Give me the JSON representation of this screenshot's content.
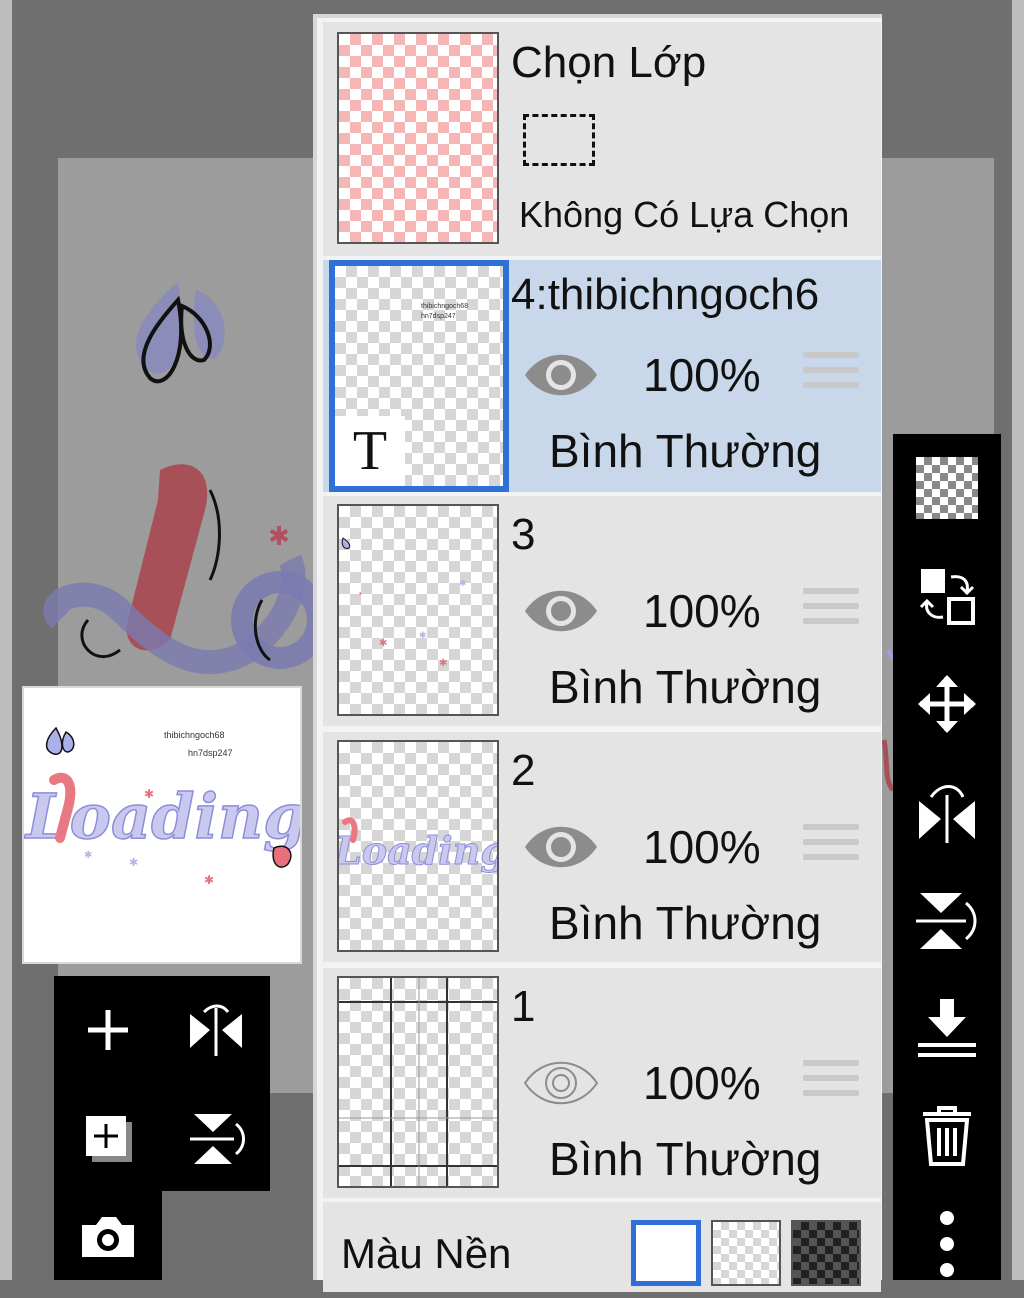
{
  "selection_layer": {
    "title": "Chọn Lớp",
    "status": "Không Có Lựa Chọn"
  },
  "layers": [
    {
      "name": "4:thibichngoch6",
      "opacity": "100%",
      "blend": "Bình Thường",
      "visible": true,
      "selected": true,
      "type_badge": "T"
    },
    {
      "name": "3",
      "opacity": "100%",
      "blend": "Bình Thường",
      "visible": true,
      "selected": false
    },
    {
      "name": "2",
      "opacity": "100%",
      "blend": "Bình Thường",
      "visible": true,
      "selected": false
    },
    {
      "name": "1",
      "opacity": "100%",
      "blend": "Bình Thường",
      "visible": false,
      "selected": false
    }
  ],
  "background": {
    "label": "Màu Nền",
    "options": [
      "white",
      "transparent",
      "dark-checker"
    ],
    "selected": "white"
  },
  "preview": {
    "artwork_text": "Loading...",
    "caption_line1": "thibichngoch68",
    "caption_line2": "hn7dsp247"
  },
  "canvas": {
    "artwork_text": "Lo"
  },
  "colors": {
    "selection_blue": "#2e6fd8",
    "selected_row": "#c9d7ea",
    "artwork_pink": "#e86f7b",
    "artwork_lavender": "#9d9fe3"
  },
  "left_toolbar": [
    "add-layer",
    "flip-horizontal",
    "add-layer-copy",
    "flip-vertical",
    "camera"
  ],
  "right_toolbar": [
    "transparency",
    "swap-layers",
    "move",
    "flip-horizontal",
    "flip-vertical",
    "merge-down",
    "delete",
    "more"
  ]
}
